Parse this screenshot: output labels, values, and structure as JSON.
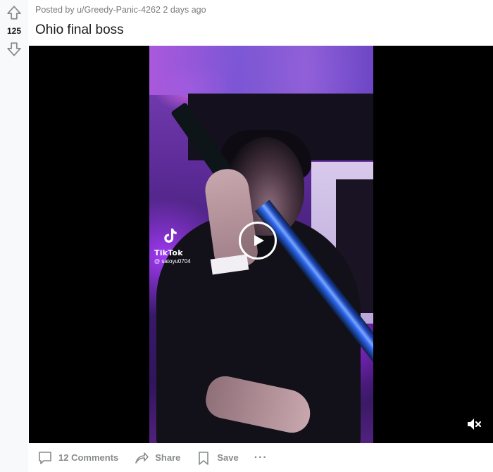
{
  "post": {
    "meta_prefix": "Posted by",
    "author": "u/Greedy-Panic-4262",
    "age": "2 days ago",
    "title": "Ohio final boss",
    "score": "125"
  },
  "video": {
    "watermark_brand": "TikTok",
    "watermark_user": "@ satoyu0704",
    "play_icon": "play-icon",
    "mute_icon": "muted-speaker-icon"
  },
  "actions": {
    "comments_label": "12 Comments",
    "share_label": "Share",
    "save_label": "Save",
    "more_label": "···"
  },
  "colors": {
    "vote_sidebar": "#f8f9fa",
    "action_text": "#878a8c",
    "meta_text": "#7c7c7c",
    "video_background": "#000000"
  }
}
